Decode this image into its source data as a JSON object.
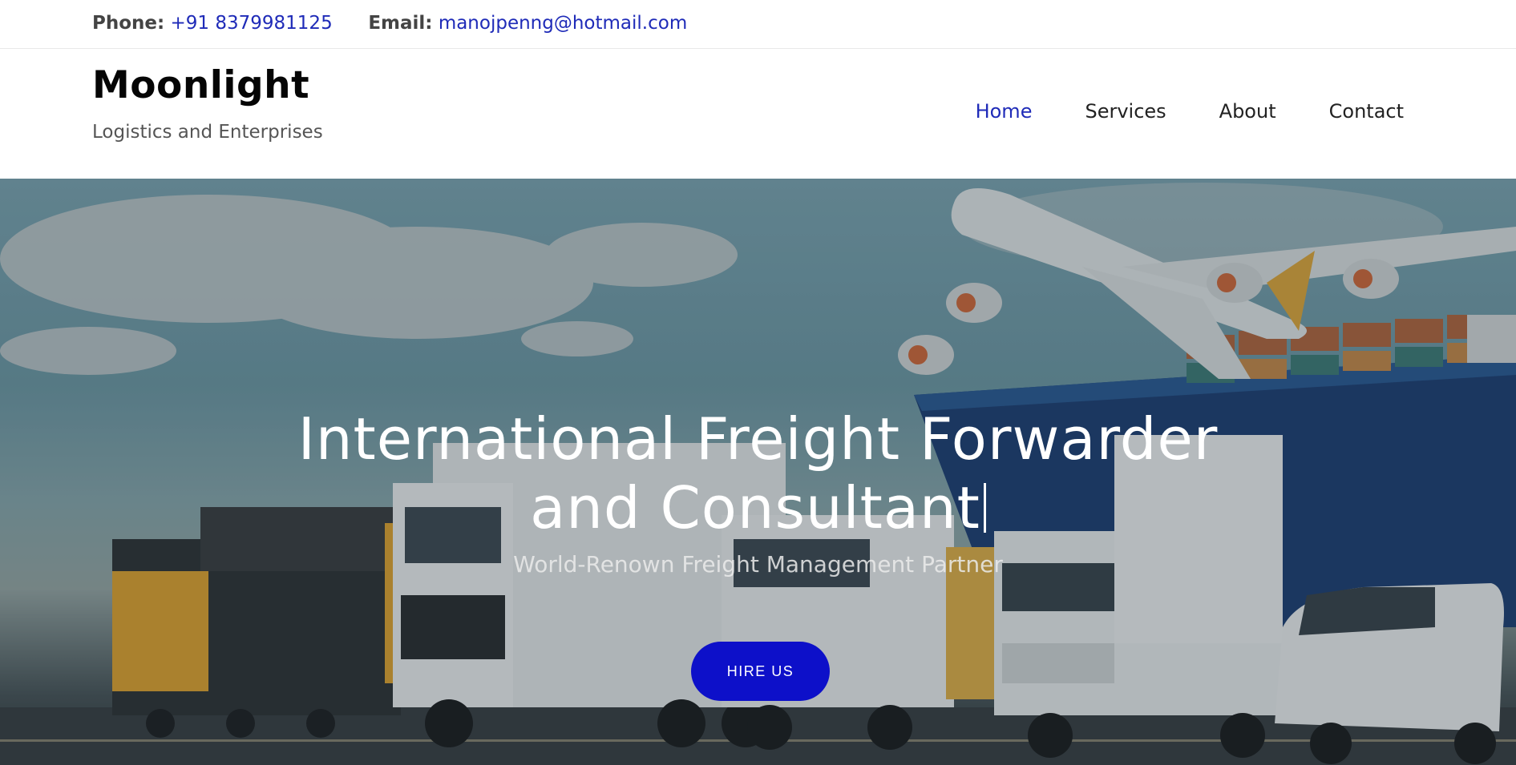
{
  "topbar": {
    "phone_label": "Phone:",
    "phone_value": "+91 8379981125",
    "email_label": "Email:",
    "email_value": "manojpenng@hotmail.com"
  },
  "brand": {
    "title": "Moonlight",
    "subtitle": "Logistics and Enterprises"
  },
  "nav": {
    "items": [
      {
        "label": "Home",
        "active": true
      },
      {
        "label": "Services",
        "active": false
      },
      {
        "label": "About",
        "active": false
      },
      {
        "label": "Contact",
        "active": false
      }
    ]
  },
  "hero": {
    "title_line1": "International Freight Forwarder",
    "title_line2": "and Consultant",
    "subtitle": "World-Renown Freight Management Partner",
    "cta_label": "HIRE US",
    "background_icons": [
      "airplane-icon",
      "cargo-ship-icon",
      "locomotive-icon",
      "truck-icon",
      "van-icon"
    ]
  },
  "colors": {
    "accent": "#1f2bb8",
    "cta": "#0d10c9"
  }
}
